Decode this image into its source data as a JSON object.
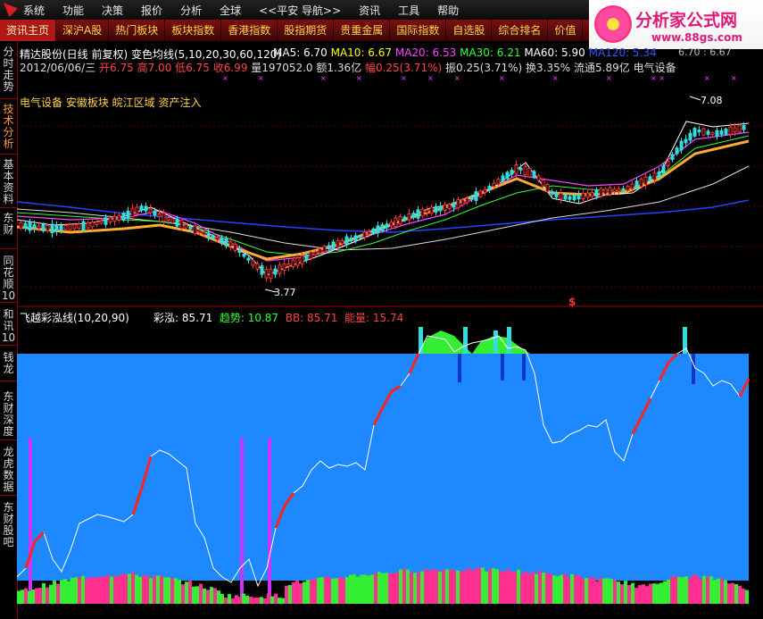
{
  "menu": [
    "系统",
    "功能",
    "决策",
    "报价",
    "分析",
    "全球",
    "<<平安 导航>>",
    "资讯",
    "工具",
    "帮助"
  ],
  "tabs": [
    "资讯主页",
    "深沪A股",
    "热门板块",
    "板块指数",
    "香港指数",
    "股指期货",
    "贵重金属",
    "国际指数",
    "自选股",
    "综合排名",
    "价值"
  ],
  "brand": {
    "name": "分析家公式网",
    "url": "www.88gs.com"
  },
  "sidebar": [
    {
      "label": "分时走势",
      "active": false
    },
    {
      "label": "技术分析",
      "active": true
    },
    {
      "label": "基本资料",
      "active": false
    },
    {
      "label": "东财",
      "active": false
    },
    {
      "label": "同花顺10",
      "active": false
    },
    {
      "label": "和讯10",
      "active": false
    },
    {
      "label": "钱龙",
      "active": false
    },
    {
      "label": "东财深度",
      "active": false
    },
    {
      "label": "龙虎数据",
      "active": false
    },
    {
      "label": "东财股吧",
      "active": false
    }
  ],
  "header": {
    "title": "精达股份(日线 前复权) 变色均线(5,10,20,30,60,120)",
    "ma": [
      {
        "label": "MA5: 6.70",
        "color": "#ffffff"
      },
      {
        "label": "MA10: 6.67",
        "color": "#ffff00"
      },
      {
        "label": "MA20: 6.53",
        "color": "#ff44ff"
      },
      {
        "label": "MA30: 6.21",
        "color": "#33ff33"
      },
      {
        "label": "MA60: 5.90",
        "color": "#ffffff"
      },
      {
        "label": "MA120: 5.34",
        "color": "#3355ff"
      }
    ],
    "quote": [
      {
        "text": "2012/06/06/三",
        "color": "#dddddd"
      },
      {
        "text": "开6.75",
        "color": "#ff4444"
      },
      {
        "text": "高7.00",
        "color": "#ff4444"
      },
      {
        "text": "低6.75",
        "color": "#ff4444"
      },
      {
        "text": "收6.99",
        "color": "#ff4444"
      },
      {
        "text": "量197052.0",
        "color": "#dddddd"
      },
      {
        "text": "额1.36亿",
        "color": "#dddddd"
      },
      {
        "text": "幅0.25(3.71%)",
        "color": "#ff4444"
      },
      {
        "text": "振0.25(3.71%)",
        "color": "#dddddd"
      },
      {
        "text": "换3.35%",
        "color": "#dddddd"
      },
      {
        "text": "流通5.89亿",
        "color": "#dddddd"
      },
      {
        "text": "电气设备",
        "color": "#dddddd"
      }
    ],
    "sectors": "电气设备 安徽板块 皖江区域 资产注入",
    "top_price": "6.70 : 6.67"
  },
  "price_labels": {
    "high": "7.08",
    "low": "3.77",
    "marker": "$"
  },
  "indicator": {
    "title": "飞越彩泓线(10,20,90)",
    "items": [
      {
        "text": "彩泓: 85.71",
        "color": "#ffffff"
      },
      {
        "text": "趋势: 10.87",
        "color": "#33ff33"
      },
      {
        "text": "BB: 85.71",
        "color": "#ff4444"
      },
      {
        "text": "能量: 15.74",
        "color": "#ff4444"
      }
    ]
  },
  "colors": {
    "blue_panel": "#1e88ff",
    "ma120": "#2244ff",
    "trend_green": "#33ff33",
    "energy_pink": "#ff2f8f",
    "highlight": "#ff9a3c"
  }
}
